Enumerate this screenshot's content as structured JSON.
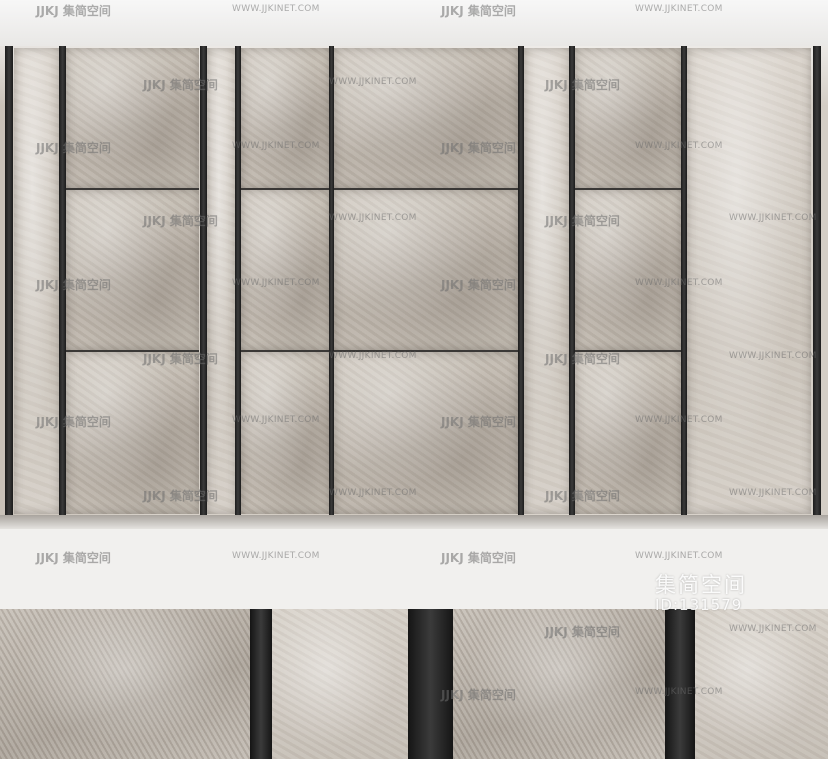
{
  "watermark": {
    "logo_text": "JJKJ 集简空间",
    "url_text": "WWW.JJKINET.COM",
    "brand_text": "集简空间",
    "id_text": "ID:131579"
  },
  "colors": {
    "stone": "#c4bcb2",
    "metal_post": "#2a2a2a",
    "background": "#f3f2f1"
  }
}
